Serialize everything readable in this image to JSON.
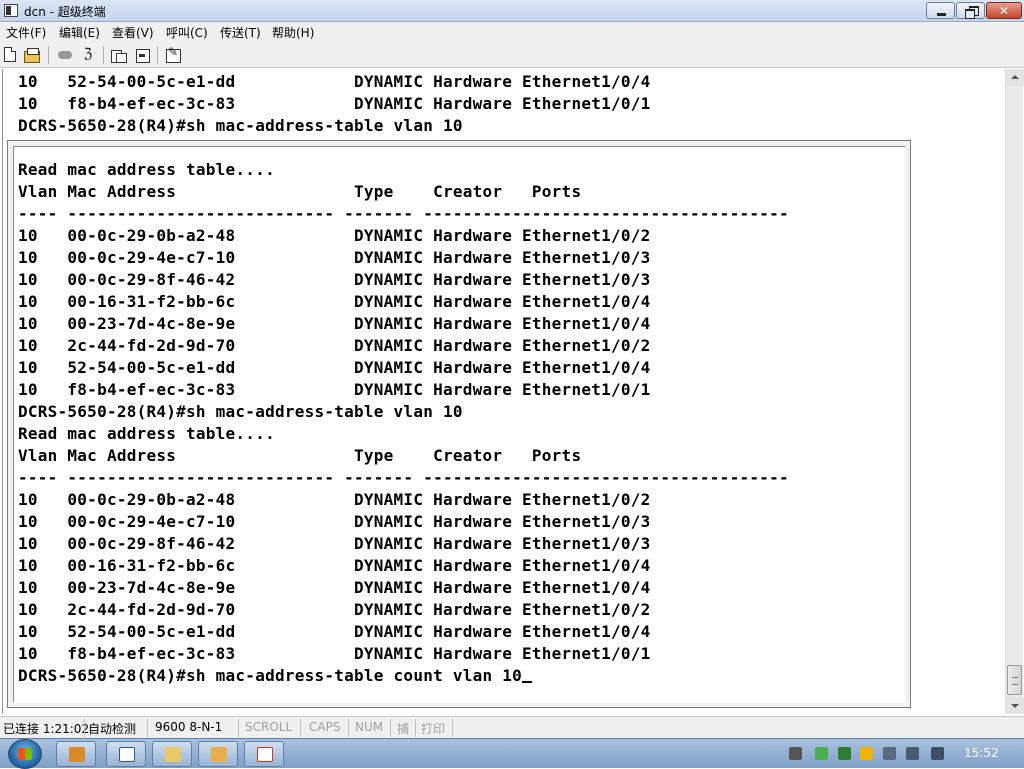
{
  "window": {
    "title": "dcn - 超级终端"
  },
  "menu": [
    {
      "label": "文件(F)"
    },
    {
      "label": "编辑(E)"
    },
    {
      "label": "查看(V)"
    },
    {
      "label": "呼叫(C)"
    },
    {
      "label": "传送(T)"
    },
    {
      "label": "帮助(H)"
    }
  ],
  "toolbar": {
    "icons": [
      "new-document-icon",
      "open-folder-icon",
      "disconnect-icon",
      "properties-icon",
      "send-file-icon",
      "receive-file-icon",
      "settings-icon"
    ]
  },
  "terminal": {
    "lines": [
      "10   52-54-00-5c-e1-dd            DYNAMIC Hardware Ethernet1/0/4",
      "10   f8-b4-ef-ec-3c-83            DYNAMIC Hardware Ethernet1/0/1",
      "DCRS-5650-28(R4)#sh mac-address-table vlan 10",
      "",
      "Read mac address table....",
      "Vlan Mac Address                  Type    Creator   Ports",
      "---- --------------------------- ------- -------------------------------------",
      "10   00-0c-29-0b-a2-48            DYNAMIC Hardware Ethernet1/0/2",
      "10   00-0c-29-4e-c7-10            DYNAMIC Hardware Ethernet1/0/3",
      "10   00-0c-29-8f-46-42            DYNAMIC Hardware Ethernet1/0/3",
      "10   00-16-31-f2-bb-6c            DYNAMIC Hardware Ethernet1/0/4",
      "10   00-23-7d-4c-8e-9e            DYNAMIC Hardware Ethernet1/0/4",
      "10   2c-44-fd-2d-9d-70            DYNAMIC Hardware Ethernet1/0/2",
      "10   52-54-00-5c-e1-dd            DYNAMIC Hardware Ethernet1/0/4",
      "10   f8-b4-ef-ec-3c-83            DYNAMIC Hardware Ethernet1/0/1",
      "DCRS-5650-28(R4)#sh mac-address-table vlan 10",
      "Read mac address table....",
      "Vlan Mac Address                  Type    Creator   Ports",
      "---- --------------------------- ------- -------------------------------------",
      "10   00-0c-29-0b-a2-48            DYNAMIC Hardware Ethernet1/0/2",
      "10   00-0c-29-4e-c7-10            DYNAMIC Hardware Ethernet1/0/3",
      "10   00-0c-29-8f-46-42            DYNAMIC Hardware Ethernet1/0/3",
      "10   00-16-31-f2-bb-6c            DYNAMIC Hardware Ethernet1/0/4",
      "10   00-23-7d-4c-8e-9e            DYNAMIC Hardware Ethernet1/0/4",
      "10   2c-44-fd-2d-9d-70            DYNAMIC Hardware Ethernet1/0/2",
      "10   52-54-00-5c-e1-dd            DYNAMIC Hardware Ethernet1/0/4",
      "10   f8-b4-ef-ec-3c-83            DYNAMIC Hardware Ethernet1/0/1",
      "DCRS-5650-28(R4)#sh mac-address-table count vlan 10"
    ]
  },
  "statusbar": {
    "connected": "已连接 1:21:02",
    "detect": "自动检测",
    "baud": "9600 8-N-1",
    "scroll": "SCROLL",
    "caps": "CAPS",
    "num": "NUM",
    "capture": "捕",
    "print": "打印"
  },
  "taskbar": {
    "clock": "15:52"
  }
}
